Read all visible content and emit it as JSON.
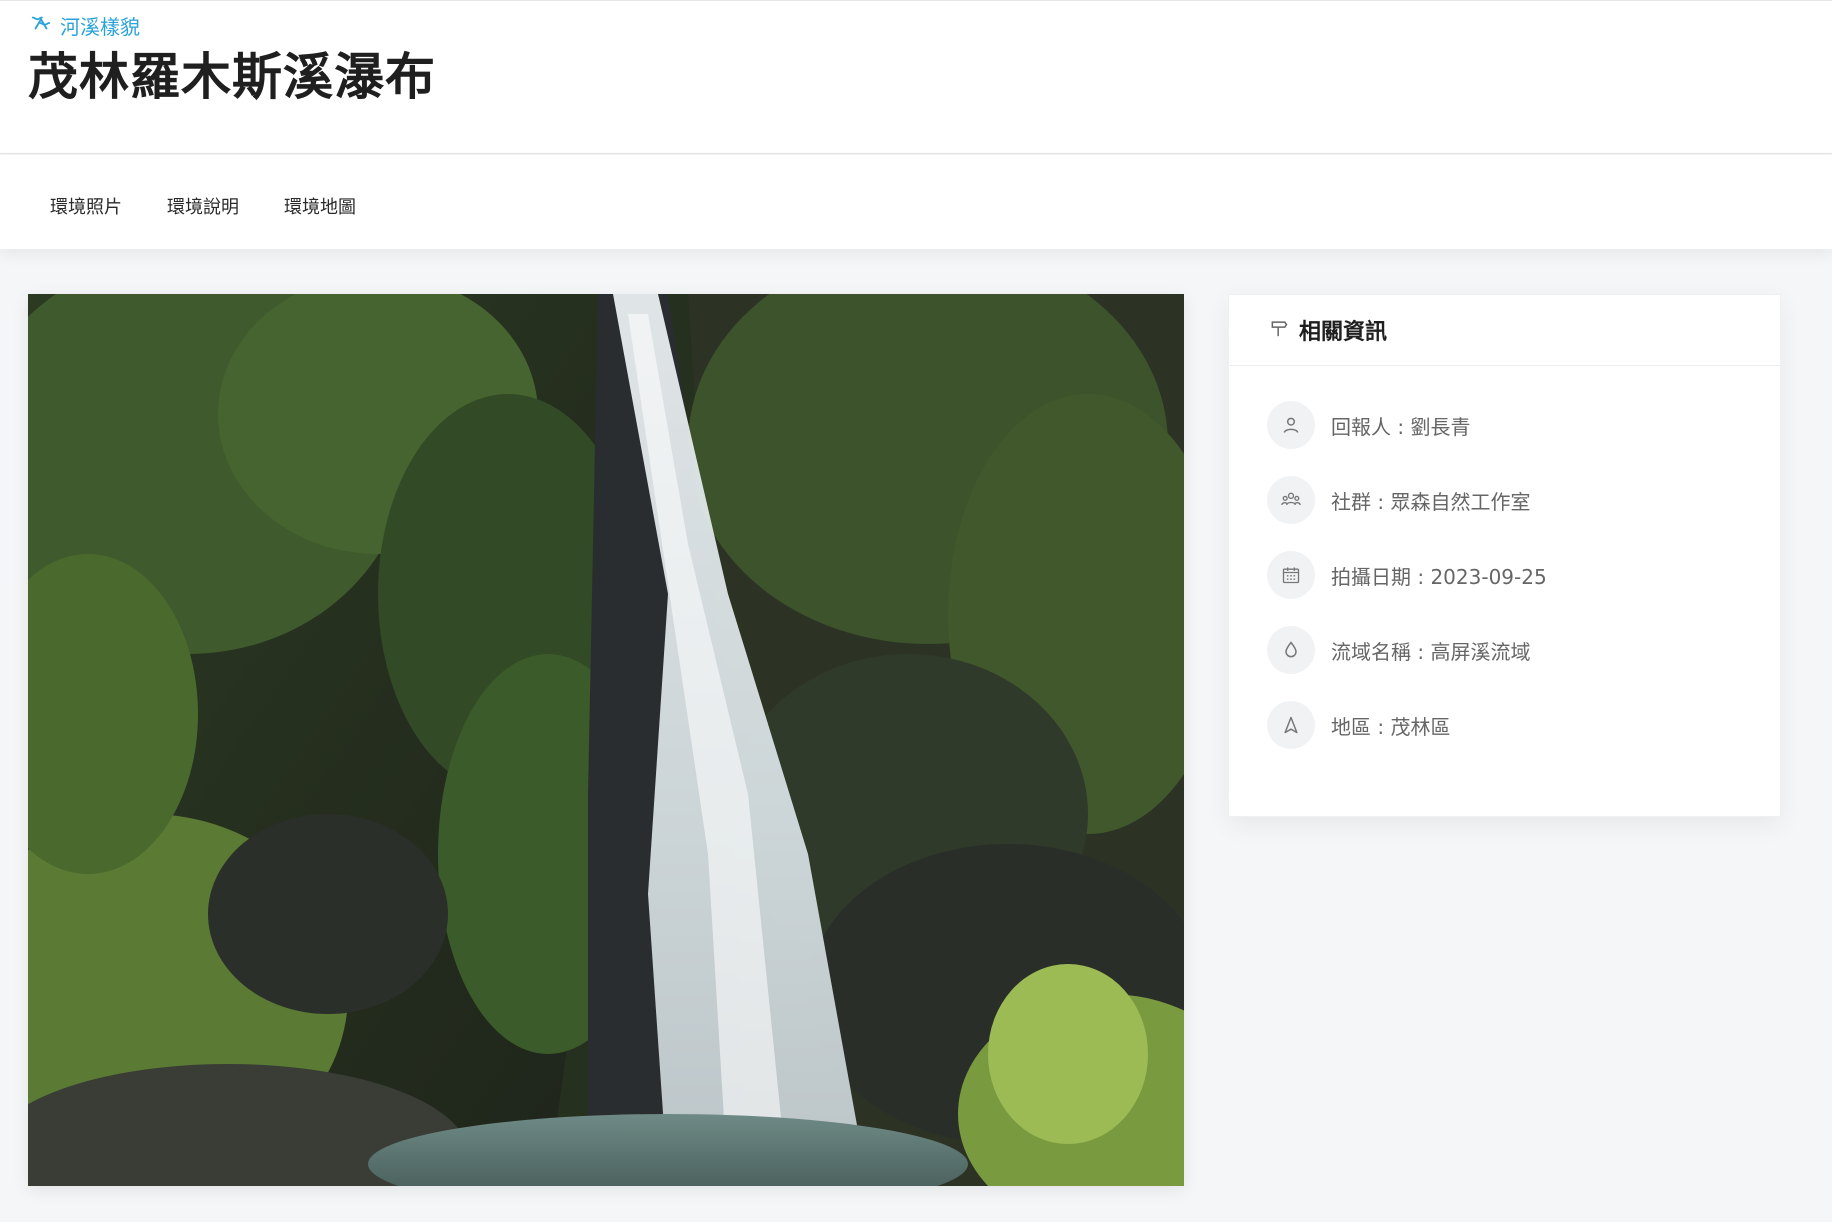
{
  "header": {
    "breadcrumb": "河溪樣貌",
    "title": "茂林羅木斯溪瀑布"
  },
  "tabs": [
    {
      "label": "環境照片"
    },
    {
      "label": "環境說明"
    },
    {
      "label": "環境地圖"
    }
  ],
  "info": {
    "title": "相關資訊",
    "items": [
      {
        "icon": "user-icon",
        "text": "回報人 : 劉長青"
      },
      {
        "icon": "group-icon",
        "text": "社群 : 眾森自然工作室"
      },
      {
        "icon": "calendar-icon",
        "text": "拍攝日期 : 2023-09-25"
      },
      {
        "icon": "water-drop-icon",
        "text": "流域名稱 : 高屏溪流域"
      },
      {
        "icon": "location-arrow-icon",
        "text": "地區 : 茂林區"
      }
    ]
  },
  "colors": {
    "accent": "#2aa3d8",
    "background": "#f5f6f8"
  }
}
